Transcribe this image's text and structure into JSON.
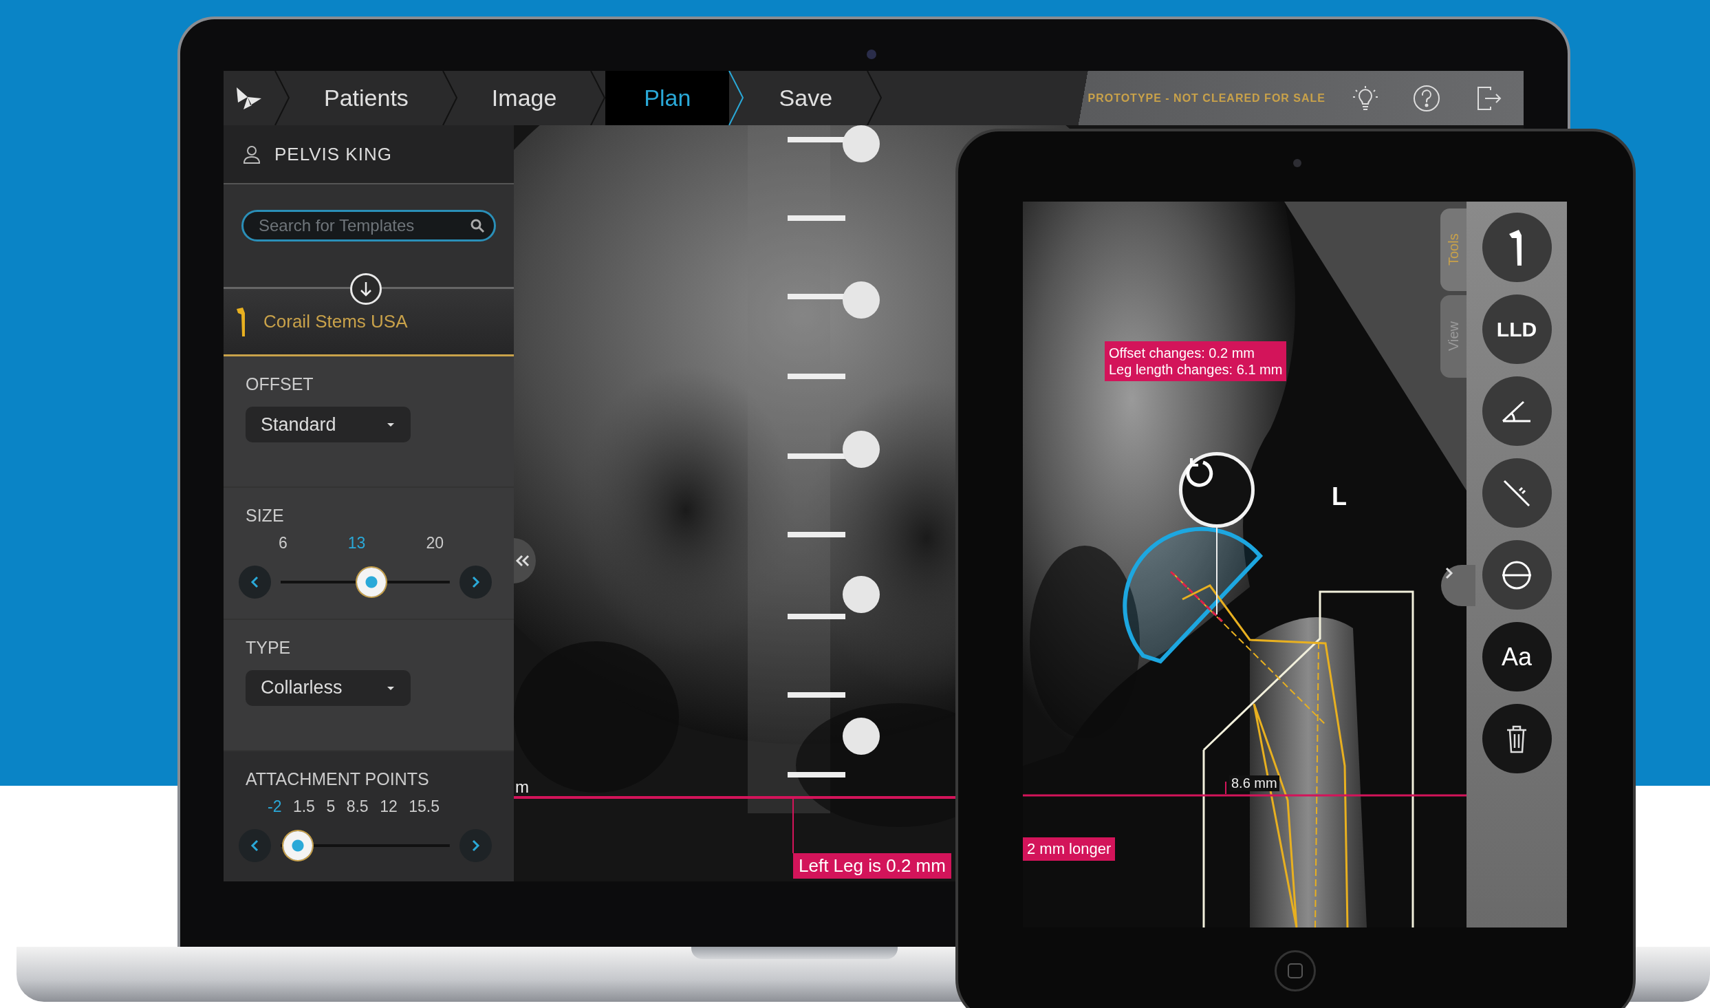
{
  "laptop": {
    "breadcrumb": [
      {
        "label": "Patients",
        "selected": false
      },
      {
        "label": "Image",
        "selected": false
      },
      {
        "label": "Plan",
        "selected": true
      },
      {
        "label": "Save",
        "selected": false
      }
    ],
    "notice": "PROTOTYPE - NOT CLEARED FOR SALE",
    "patient": "PELVIS KING",
    "search": {
      "placeholder": "Search for Templates"
    },
    "template": "Corail Stems USA",
    "sections": [
      {
        "kind": "dropdown",
        "label": "OFFSET",
        "value": "Standard"
      },
      {
        "kind": "slider",
        "label": "SIZE",
        "level": 0.545,
        "ticks": [
          {
            "label": "6",
            "selected": false
          },
          {
            "label": "13",
            "selected": true
          },
          {
            "label": "20",
            "selected": false
          }
        ]
      },
      {
        "kind": "dropdown",
        "label": "TYPE",
        "value": "Collarless"
      },
      {
        "kind": "slider",
        "label": "ATTACHMENT POINTS",
        "level": 0.01,
        "ticks": [
          {
            "label": "-2",
            "selected": true
          },
          {
            "label": "1.5",
            "selected": false
          },
          {
            "label": "5",
            "selected": false
          },
          {
            "label": "8.5",
            "selected": false
          },
          {
            "label": "12",
            "selected": false
          },
          {
            "label": "15.5",
            "selected": false
          }
        ]
      }
    ],
    "xray": {
      "edge_label": "m",
      "leg_note": "Left Leg is 0.2 mm"
    }
  },
  "tablet": {
    "side_tabs": [
      {
        "label": "Tools",
        "selected": true
      },
      {
        "label": "View",
        "selected": false
      }
    ],
    "change_note": [
      "Offset changes: 0.2 mm",
      "Leg length changes: 6.1 mm"
    ],
    "side_label": "L",
    "measure": "8.6 mm",
    "leg_note": "2 mm longer",
    "tools": [
      {
        "kind": "stem"
      },
      {
        "kind": "text",
        "label": "LLD"
      },
      {
        "kind": "angle"
      },
      {
        "kind": "ruler"
      },
      {
        "kind": "circle"
      },
      {
        "kind": "text",
        "label": "Aa"
      },
      {
        "kind": "trash"
      }
    ]
  }
}
